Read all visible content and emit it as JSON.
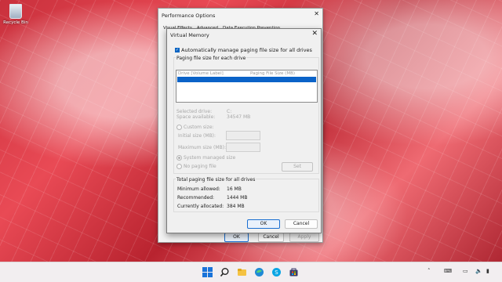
{
  "desktop": {
    "recycle_bin_label": "Recycle Bin"
  },
  "performance_options": {
    "title": "Performance Options",
    "tabs": [
      "Visual Effects",
      "Advanced",
      "Data Execution Prevention"
    ],
    "ok": "OK",
    "cancel": "Cancel",
    "apply": "Apply"
  },
  "virtual_memory": {
    "title": "Virtual Memory",
    "auto_manage": "Automatically manage paging file size for all drives",
    "paging_group_title": "Paging file size for each drive",
    "col_drive": "Drive  [Volume Label]",
    "col_size": "Paging File Size (MB)",
    "selected_drive_label": "Selected drive:",
    "selected_drive_value": "C:",
    "space_available_label": "Space available:",
    "space_available_value": "34547 MB",
    "custom_size": "Custom size:",
    "initial_size": "Initial size (MB):",
    "maximum_size": "Maximum size (MB):",
    "system_managed": "System managed size",
    "no_paging": "No paging file",
    "set": "Set",
    "total_group_title": "Total paging file size for all drives",
    "min_allowed_label": "Minimum allowed:",
    "min_allowed_value": "16 MB",
    "recommended_label": "Recommended:",
    "recommended_value": "1444 MB",
    "currently_label": "Currently allocated:",
    "currently_value": "384 MB",
    "ok": "OK",
    "cancel": "Cancel"
  },
  "taskbar": {
    "icons": [
      "windows-start-icon",
      "search-icon",
      "file-explorer-icon",
      "edge-icon",
      "skype-icon",
      "microsoft-store-icon",
      "app-icon"
    ],
    "tray_icons": [
      "chevron-up-icon",
      "speaker-icon",
      "network-icon",
      "keyboard-icon",
      "battery-icon"
    ]
  }
}
